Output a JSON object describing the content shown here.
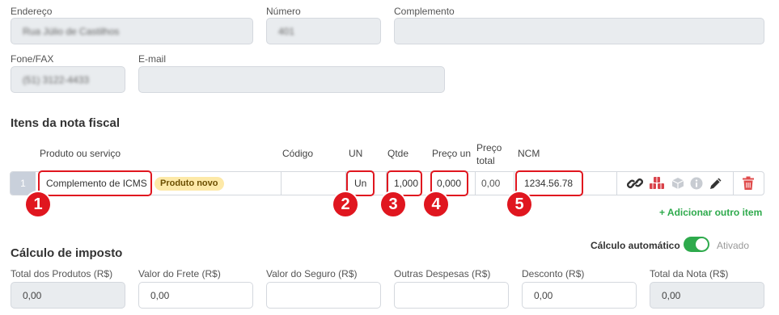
{
  "address": {
    "endereco_label": "Endereço",
    "endereco_value": "Rua Júlio de Castilhos",
    "numero_label": "Número",
    "numero_value": "401",
    "complemento_label": "Complemento",
    "complemento_value": "",
    "fone_label": "Fone/FAX",
    "fone_value": "(51) 3122-4433",
    "email_label": "E-mail",
    "email_value": ""
  },
  "items": {
    "section_title": "Itens da nota fiscal",
    "headers": {
      "produto": "Produto ou serviço",
      "codigo": "Código",
      "un": "UN",
      "qtde": "Qtde",
      "preco_un": "Preço un",
      "preco_total_1": "Preço",
      "preco_total_2": "total",
      "ncm": "NCM"
    },
    "row": {
      "index": "1",
      "produto": "Complemento de ICMS",
      "badge": "Produto novo",
      "codigo": "",
      "un": "Un",
      "qtde": "1,000",
      "preco_un": "0,000",
      "preco_total": "0,00",
      "ncm": "1234.56.78"
    },
    "add_item": "+ Adicionar outro item",
    "annotations": [
      "1",
      "2",
      "3",
      "4",
      "5"
    ]
  },
  "tax": {
    "section_title": "Cálculo de imposto",
    "auto_label": "Cálculo automático",
    "auto_state": "Ativado",
    "fields": [
      {
        "label": "Total dos Produtos (R$)",
        "value": "0,00"
      },
      {
        "label": "Valor do Frete (R$)",
        "value": "0,00"
      },
      {
        "label": "Valor do Seguro (R$)",
        "value": ""
      },
      {
        "label": "Outras Despesas (R$)",
        "value": ""
      },
      {
        "label": "Desconto (R$)",
        "value": "0,00"
      },
      {
        "label": "Total da Nota (R$)",
        "value": "0,00"
      }
    ]
  },
  "colors": {
    "accent_green": "#2eaa4c",
    "annotation_red": "#e0161f",
    "badge_yellow": "#fde9a8",
    "delete_red": "#e04b4b"
  },
  "icons": [
    "link-icon",
    "boxes-icon",
    "box-icon",
    "info-icon",
    "pencil-icon",
    "trash-icon"
  ]
}
